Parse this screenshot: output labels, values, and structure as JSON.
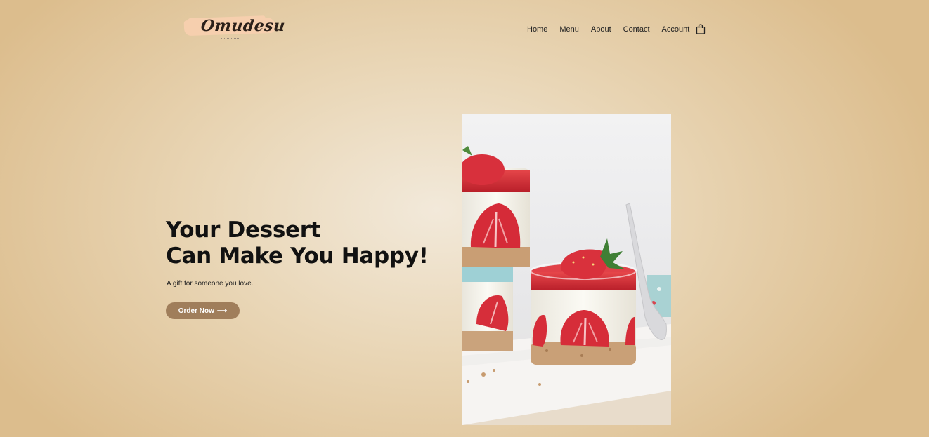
{
  "brand": {
    "name": "Omudesu"
  },
  "nav": {
    "items": [
      {
        "label": "Home"
      },
      {
        "label": "Menu"
      },
      {
        "label": "About"
      },
      {
        "label": "Contact"
      },
      {
        "label": "Account"
      }
    ],
    "cart_icon": "shopping-bag-icon"
  },
  "hero": {
    "title_line1": "Your Dessert",
    "title_line2": "Can Make You Happy!",
    "subtitle": "A gift for someone you love.",
    "button_label": "Order Now",
    "button_arrow": "⟶"
  },
  "image": {
    "subject": "strawberry-cheesecake-jars"
  },
  "colors": {
    "button": "#a07e5b",
    "background": "#e9d6b6",
    "logo_brush": "#f6cfae"
  }
}
